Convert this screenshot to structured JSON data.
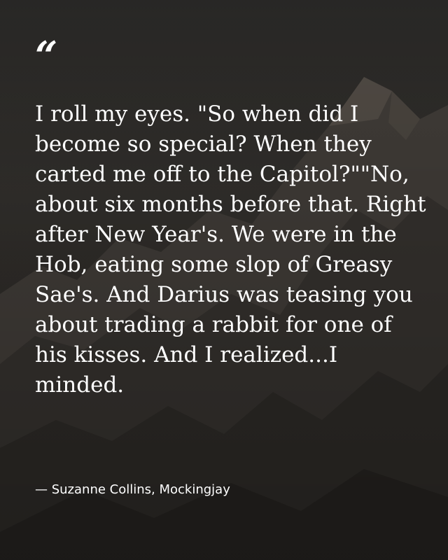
{
  "quote": {
    "mark": "“",
    "text": "I roll my eyes. \"So when did I become so special? When they carted me off to the Capitol?\"\"No, about six months before that. Right after New Year's. We were in the Hob, eating some slop of Greasy Sae's. And Darius was teasing you about trading a rabbit for one of his kisses. And I realized...I minded.",
    "attribution": "— Suzanne Collins, Mockingjay"
  },
  "colors": {
    "text": "#ffffff",
    "background_dark": "#2b2a28"
  }
}
